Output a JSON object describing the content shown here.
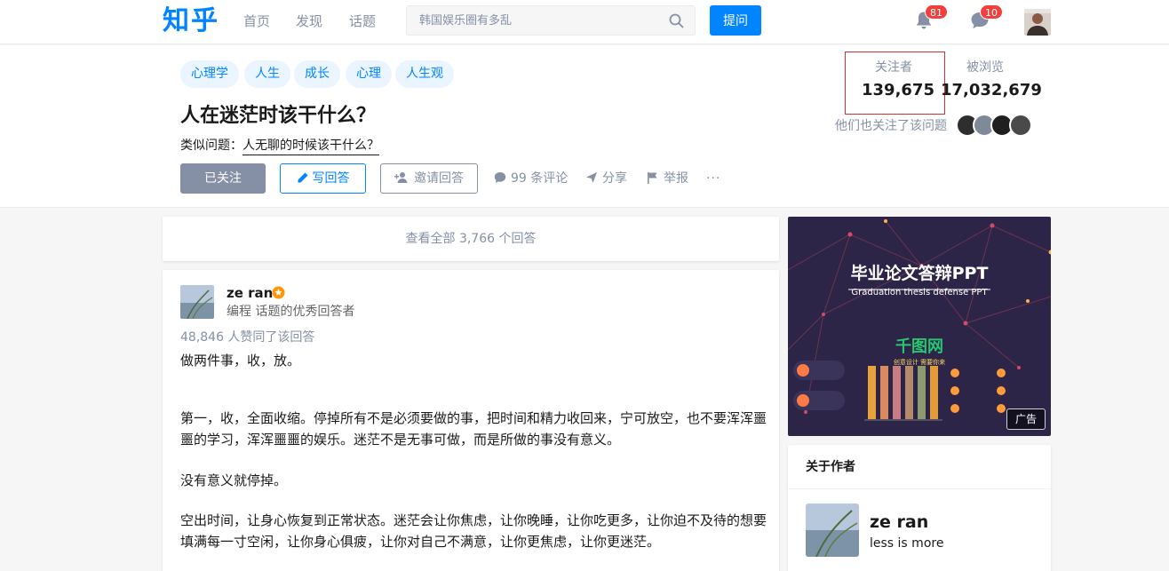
{
  "header": {
    "logo": "知乎",
    "nav": [
      "首页",
      "发现",
      "话题"
    ],
    "search_placeholder": "韩国娱乐圈有多乱",
    "ask_label": "提问",
    "notifications_count": "81",
    "messages_count": "10"
  },
  "question": {
    "tags": [
      "心理学",
      "人生",
      "成长",
      "心理",
      "人生观"
    ],
    "title": "人在迷茫时该干什么？",
    "similar_label": "类似问题：",
    "similar_link": "人无聊的时候该干什么？",
    "follow_label": "已关注",
    "write_label": "写回答",
    "invite_label": "邀请回答",
    "comments_label": "99 条评论",
    "share_label": "分享",
    "report_label": "举报",
    "more_label": "···",
    "followers_label": "关注者",
    "followers_value": "139,675",
    "views_label": "被浏览",
    "views_value": "17,032,679",
    "also_follow_label": "他们也关注了该问题"
  },
  "answers": {
    "view_all_label": "查看全部 3,766 个回答",
    "author_name": "ze ran",
    "author_headline": "编程 话题的优秀回答者",
    "votes_label": "48,846 人赞同了该回答",
    "paragraphs": [
      "做两件事，收，放。",
      "第一，收，全面收缩。停掉所有不是必须要做的事，把时间和精力收回来，宁可放空，也不要浑浑噩噩的学习，浑浑噩噩的娱乐。迷茫不是无事可做，而是所做的事没有意义。",
      "没有意义就停掉。",
      "空出时间，让身心恢复到正常状态。迷茫会让你焦虑，让你晚睡，让你吃更多，让你迫不及待的想要填满每一寸空闲，让你身心俱疲，让你对自己不满意，让你更焦虑，让你更迷茫。"
    ]
  },
  "ad": {
    "title": "毕业论文答辩PPT",
    "subtitle": "Graduation thesis defense PPT",
    "brand": "千图网",
    "brand_sub": "创意设计 需要你来",
    "label": "广告"
  },
  "author_card": {
    "title": "关于作者",
    "name": "ze ran",
    "bio": "less is more"
  },
  "colors": {
    "brand": "#0084ff",
    "muted": "#8590a6",
    "badge": "#f1403c",
    "ad_bg": "#2c2547"
  }
}
